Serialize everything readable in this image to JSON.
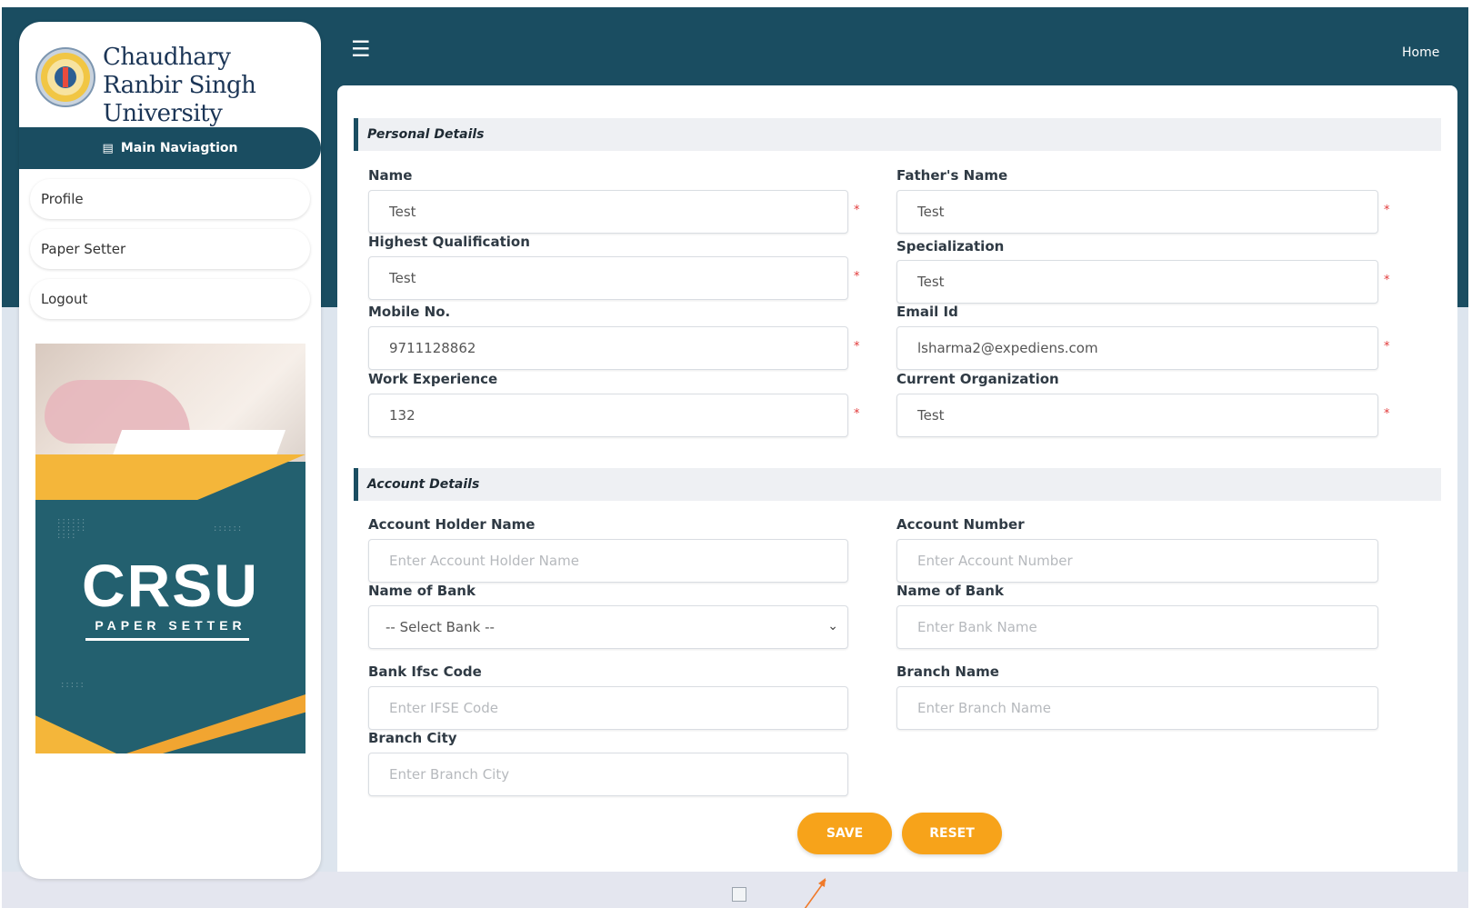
{
  "university": {
    "name_line1": "Chaudhary Ranbir Singh",
    "name_line2": "University"
  },
  "sidebar": {
    "nav_header": "Main Naviagtion",
    "items": [
      {
        "label": "Profile"
      },
      {
        "label": "Paper Setter"
      },
      {
        "label": "Logout"
      }
    ],
    "banner_title": "CRSU",
    "banner_subtitle": "PAPER SETTER"
  },
  "topbar": {
    "home_label": "Home"
  },
  "personal": {
    "section_title": "Personal Details",
    "name": {
      "label": "Name",
      "value": "Test"
    },
    "father_name": {
      "label": "Father's Name",
      "value": "Test"
    },
    "qualification": {
      "label": "Highest Qualification",
      "value": "Test"
    },
    "specialization": {
      "label": "Specialization",
      "value": "Test"
    },
    "mobile": {
      "label": "Mobile No.",
      "value": "9711128862"
    },
    "email": {
      "label": "Email Id",
      "value": "lsharma2@expediens.com"
    },
    "experience": {
      "label": "Work Experience",
      "value": "132"
    },
    "organization": {
      "label": "Current Organization",
      "value": "Test"
    }
  },
  "account": {
    "section_title": "Account Details",
    "holder_name": {
      "label": "Account Holder Name",
      "placeholder": "Enter Account Holder Name"
    },
    "account_number": {
      "label": "Account Number",
      "placeholder": "Enter Account Number"
    },
    "bank_select": {
      "label": "Name of Bank",
      "selected": "-- Select Bank --"
    },
    "bank_name": {
      "label": "Name of Bank",
      "placeholder": "Enter Bank Name"
    },
    "ifsc": {
      "label": "Bank Ifsc Code",
      "placeholder": "Enter IFSE Code"
    },
    "branch_name": {
      "label": "Branch Name",
      "placeholder": "Enter Branch Name"
    },
    "branch_city": {
      "label": "Branch City",
      "placeholder": "Enter Branch City"
    }
  },
  "actions": {
    "save": "SAVE",
    "reset": "RESET"
  },
  "colors": {
    "primary": "#1a4d61",
    "accent": "#f7a31a",
    "required": "#e23a3a"
  },
  "icons": {
    "nav_header": "list-icon",
    "menu": "hamburger-icon",
    "select": "chevron-down-icon"
  }
}
